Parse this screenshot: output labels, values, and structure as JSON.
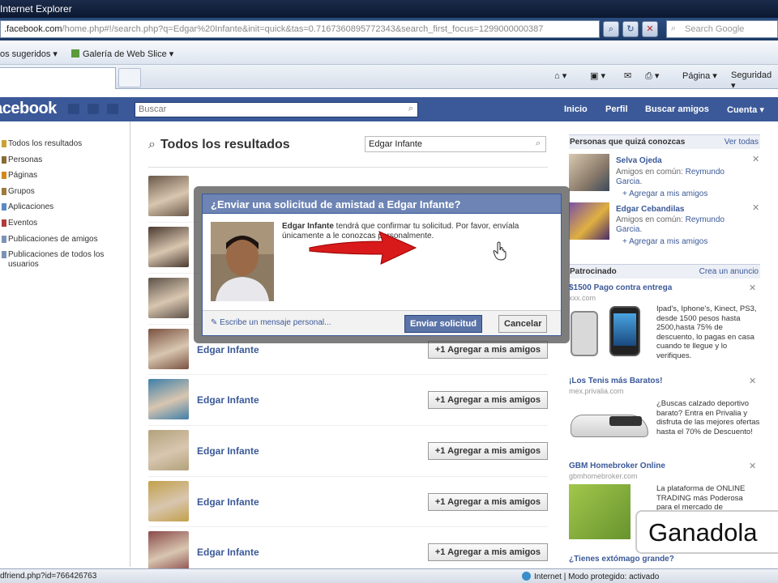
{
  "browser": {
    "window_title": "Internet Explorer",
    "address_prefix": "",
    "address_domain": ".facebook.com",
    "address_rest": "/home.php#!/search.php?q=Edgar%20Infante&init=quick&tas=0.7167360895772343&search_first_focus=1299000000387",
    "search_placeholder": "Search Google",
    "favorites": {
      "item1": "os sugeridos ▾",
      "item2": "Galería de Web Slice ▾"
    },
    "commands": {
      "page": "Página ▾",
      "security": "Seguridad ▾"
    },
    "status_url": "dfriend.php?id=766426763",
    "status_zone": "Internet | Modo protegido: activado"
  },
  "fb_header": {
    "logo": "facebook",
    "search_placeholder": "Buscar",
    "nav": {
      "home": "Inicio",
      "profile": "Perfil",
      "find_friends": "Buscar amigos",
      "account": "Cuenta ▾"
    }
  },
  "sidebar": {
    "items": [
      {
        "label": "Todos los resultados",
        "color": "#c8a233"
      },
      {
        "label": "Personas",
        "color": "#8a6a3a"
      },
      {
        "label": "Páginas",
        "color": "#d4881c"
      },
      {
        "label": "Grupos",
        "color": "#9c7b3c"
      },
      {
        "label": "Aplicaciones",
        "color": "#5a89c4"
      },
      {
        "label": "Eventos",
        "color": "#b23b3b"
      },
      {
        "label": "Publicaciones de amigos",
        "color": "#7c93b5"
      },
      {
        "label": "Publicaciones de todos los usuarios",
        "color": "#7c93b5"
      }
    ]
  },
  "main": {
    "title": "Todos los resultados",
    "search_value": "Edgar Infante",
    "results": [
      {
        "name": "",
        "button": "",
        "tone": "#6b5a4a"
      },
      {
        "name": "",
        "button": "",
        "tone": "#4a3a30"
      },
      {
        "name": "",
        "button": "",
        "tone": "#5d5248"
      },
      {
        "name": "Edgar Infante",
        "button": "+1 Agregar a mis amigos",
        "tone": "#7a5240"
      },
      {
        "name": "Edgar Infante",
        "button": "+1 Agregar a mis amigos",
        "tone": "#3f7fa8"
      },
      {
        "name": "Edgar Infante",
        "button": "+1 Agregar a mis amigos",
        "tone": "#b2a27a"
      },
      {
        "name": "Edgar Infante",
        "button": "+1 Agregar a mis amigos",
        "tone": "#c2a04a"
      },
      {
        "name": "Edgar Infante",
        "button": "+1 Agregar a mis amigos",
        "tone": "#8a4a4a"
      }
    ]
  },
  "dialog": {
    "title": "¿Enviar una solicitud de amistad a Edgar Infante?",
    "message_name": "Edgar Infante",
    "message_text": " tendrá que confirmar tu solicitud. Por favor, envíala únicamente a le conozcas personalmente.",
    "personal_message_link": "Escribe un mensaje personal...",
    "send_button": "Enviar solicitud",
    "cancel_button": "Cancelar"
  },
  "right": {
    "pymk_heading": "Personas que quizá conozcas",
    "see_all": "Ver todas",
    "people": [
      {
        "name": "Selva Ojeda",
        "mutual_prefix": "Amigos en común:",
        "mutual_name": "Reymundo Garcia.",
        "add": "Agregar a mis amigos"
      },
      {
        "name": "Edgar Cebandilas",
        "mutual_prefix": "Amigos en común:",
        "mutual_name": "Reymundo Garcia.",
        "add": "Agregar a mis amigos"
      }
    ],
    "sponsored_heading": "Patrocinado",
    "create_ad": "Crea un anuncio",
    "ads": [
      {
        "title": "$1500 Pago contra entrega",
        "url": "xxx.com",
        "text": "Ipad's, Iphone's, Kinect, PS3, desde 1500 pesos hasta 2500,hasta 75% de descuento, lo pagas en casa cuando te llegue y lo verifiques."
      },
      {
        "title": "¡Los Tenis más Baratos!",
        "url": "mex.privalia.com",
        "text": "¿Buscas calzado deportivo barato? Entra en Privalia y disfruta de las mejores ofertas hasta el 70% de Descuento!"
      },
      {
        "title": "GBM Homebroker Online",
        "url": "gbmhomebroker.com",
        "text": "La plataforma de ONLINE TRADING más Poderosa para el mercado de"
      },
      {
        "title": "¿Tienes extómago grande?"
      }
    ]
  },
  "watermark": "Ganadola"
}
